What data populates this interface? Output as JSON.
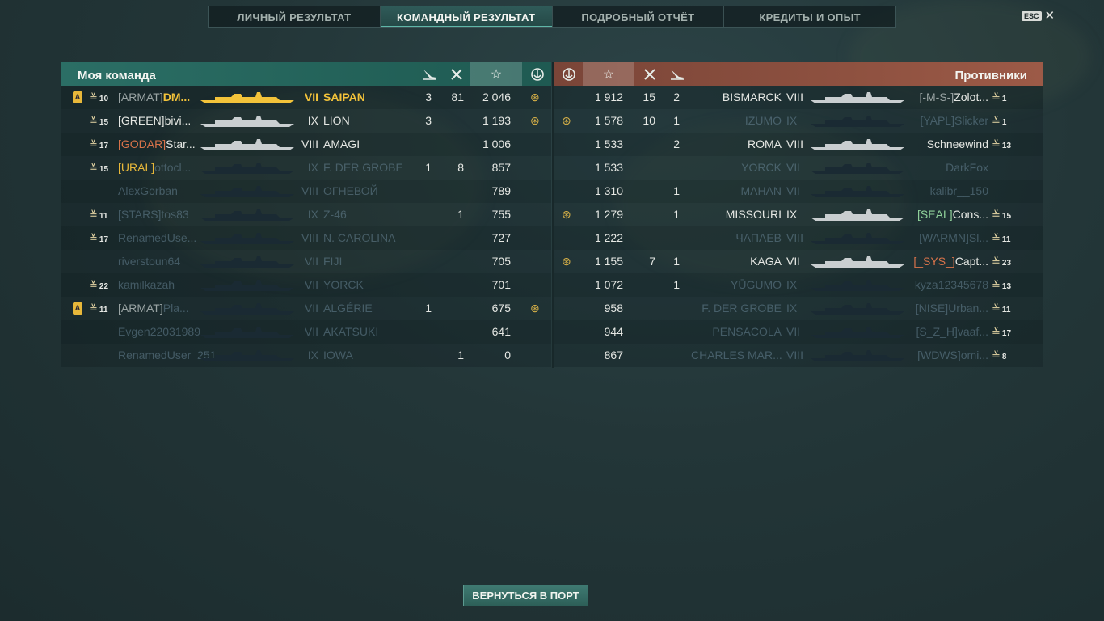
{
  "tabs": [
    {
      "label": "ЛИЧНЫЙ РЕЗУЛЬТАТ",
      "active": false
    },
    {
      "label": "КОМАНДНЫЙ РЕЗУЛЬТАТ",
      "active": true
    },
    {
      "label": "ПОДРОБНЫЙ ОТЧЁТ",
      "active": false
    },
    {
      "label": "КРЕДИТЫ И ОПЫТ",
      "active": false
    }
  ],
  "esc_label": "ESC",
  "my_team": {
    "title": "Моя команда",
    "rows": [
      {
        "div": "A",
        "rank": "10",
        "clan": "[ARMAT]",
        "clan_color": "grey",
        "name": "DM...",
        "tier": "VII",
        "ship": "SAIPAN",
        "planes": "3",
        "frags": "81",
        "xp": "2 046",
        "medal": true,
        "me": true
      },
      {
        "div": "",
        "rank": "15",
        "clan": "[GREEN]",
        "clan_color": "",
        "name": "bivi...",
        "tier": "IX",
        "ship": "LION",
        "planes": "3",
        "frags": "",
        "xp": "1 193",
        "medal": true
      },
      {
        "div": "",
        "rank": "17",
        "clan": "[GODAR]",
        "clan_color": "orange",
        "name": "Star...",
        "tier": "VIII",
        "ship": "AMAGI",
        "planes": "",
        "frags": "",
        "xp": "1 006",
        "medal": false
      },
      {
        "div": "",
        "rank": "15",
        "clan": "[URAL]",
        "clan_color": "gold",
        "name": "ottocl...",
        "tier": "IX",
        "ship": "F. DER GROBE",
        "planes": "1",
        "frags": "8",
        "xp": "857",
        "medal": false,
        "dead": true
      },
      {
        "div": "",
        "rank": "",
        "clan": "",
        "clan_color": "",
        "name": "AlexGorban",
        "tier": "VIII",
        "ship": "ОГНЕВОЙ",
        "planes": "",
        "frags": "",
        "xp": "789",
        "medal": false,
        "dead": true
      },
      {
        "div": "",
        "rank": "11",
        "clan": "[STARS]",
        "clan_color": "",
        "name": "tos83",
        "tier": "IX",
        "ship": "Z-46",
        "planes": "",
        "frags": "1",
        "xp": "755",
        "medal": false,
        "dead": true
      },
      {
        "div": "",
        "rank": "17",
        "clan": "",
        "clan_color": "",
        "name": "RenamedUse...",
        "tier": "VIII",
        "ship": "N. CAROLINA",
        "planes": "",
        "frags": "",
        "xp": "727",
        "medal": false,
        "dead": true
      },
      {
        "div": "",
        "rank": "",
        "clan": "",
        "clan_color": "",
        "name": "riverstoun64",
        "tier": "VII",
        "ship": "FIJI",
        "planes": "",
        "frags": "",
        "xp": "705",
        "medal": false,
        "dead": true
      },
      {
        "div": "",
        "rank": "22",
        "clan": "",
        "clan_color": "",
        "name": "kamilkazah",
        "tier": "VII",
        "ship": "YORCK",
        "planes": "",
        "frags": "",
        "xp": "701",
        "medal": false,
        "dead": true
      },
      {
        "div": "A",
        "rank": "11",
        "clan": "[ARMAT]",
        "clan_color": "grey",
        "name": "Pla...",
        "tier": "VII",
        "ship": "ALGÉRIE",
        "planes": "1",
        "frags": "",
        "xp": "675",
        "medal": true,
        "dead": true
      },
      {
        "div": "",
        "rank": "",
        "clan": "",
        "clan_color": "",
        "name": "Evgen22031989",
        "tier": "VII",
        "ship": "AKATSUKI",
        "planes": "",
        "frags": "",
        "xp": "641",
        "medal": false,
        "dead": true
      },
      {
        "div": "",
        "rank": "",
        "clan": "",
        "clan_color": "",
        "name": "RenamedUser_251...",
        "tier": "IX",
        "ship": "IOWA",
        "planes": "",
        "frags": "1",
        "xp": "0",
        "medal": false,
        "dead": true
      }
    ]
  },
  "enemy_team": {
    "title": "Противники",
    "rows": [
      {
        "medal": false,
        "xp": "1 912",
        "frags": "15",
        "planes": "2",
        "ship": "BISMARCK",
        "tier": "VIII",
        "clan": "[-M-S-]",
        "clan_color": "grey",
        "name": "Zolot...",
        "rank": "1"
      },
      {
        "medal": true,
        "xp": "1 578",
        "frags": "10",
        "planes": "1",
        "ship": "IZUMO",
        "tier": "IX",
        "clan": "[YAPL]",
        "clan_color": "gold",
        "name": "Slicker",
        "rank": "1",
        "dead": true
      },
      {
        "medal": false,
        "xp": "1 533",
        "frags": "",
        "planes": "2",
        "ship": "ROMA",
        "tier": "VIII",
        "clan": "",
        "clan_color": "",
        "name": "Schneewind",
        "rank": "13"
      },
      {
        "medal": false,
        "xp": "1 533",
        "frags": "",
        "planes": "",
        "ship": "YORCK",
        "tier": "VII",
        "clan": "",
        "clan_color": "",
        "name": "DarkFox",
        "rank": "",
        "dead": true
      },
      {
        "medal": false,
        "xp": "1 310",
        "frags": "",
        "planes": "1",
        "ship": "MAHAN",
        "tier": "VII",
        "clan": "",
        "clan_color": "",
        "name": "kalibr__150",
        "rank": "",
        "dead": true
      },
      {
        "medal": true,
        "xp": "1 279",
        "frags": "",
        "planes": "1",
        "ship": "MISSOURI",
        "tier": "IX",
        "clan": "[SEAL]",
        "clan_color": "green",
        "name": "Cons...",
        "rank": "15"
      },
      {
        "medal": false,
        "xp": "1 222",
        "frags": "",
        "planes": "",
        "ship": "ЧАПАЕВ",
        "tier": "VIII",
        "clan": "[WARMN]",
        "clan_color": "gold",
        "name": "Sl...",
        "rank": "11",
        "dead": true
      },
      {
        "medal": true,
        "xp": "1 155",
        "frags": "7",
        "planes": "1",
        "ship": "KAGA",
        "tier": "VII",
        "clan": "[_SYS_]",
        "clan_color": "orange",
        "name": "Capt...",
        "rank": "23"
      },
      {
        "medal": false,
        "xp": "1 072",
        "frags": "",
        "planes": "1",
        "ship": "YŪGUMO",
        "tier": "IX",
        "clan": "",
        "clan_color": "",
        "name": "kyza12345678",
        "rank": "13",
        "dead": true
      },
      {
        "medal": false,
        "xp": "958",
        "frags": "",
        "planes": "",
        "ship": "F. DER GROBE",
        "tier": "IX",
        "clan": "[NISE]",
        "clan_color": "orange",
        "name": "Urban...",
        "rank": "11",
        "dead": true
      },
      {
        "medal": false,
        "xp": "944",
        "frags": "",
        "planes": "",
        "ship": "PENSACOLA",
        "tier": "VII",
        "clan": "[S_Z_H]",
        "clan_color": "",
        "name": "vaaf...",
        "rank": "17",
        "dead": true
      },
      {
        "medal": false,
        "xp": "867",
        "frags": "",
        "planes": "",
        "ship": "CHARLES MAR...",
        "tier": "VIII",
        "clan": "[WDWS]",
        "clan_color": "orange",
        "name": "omi...",
        "rank": "8",
        "dead": true
      }
    ]
  },
  "return_button": "ВЕРНУТЬСЯ В ПОРТ"
}
